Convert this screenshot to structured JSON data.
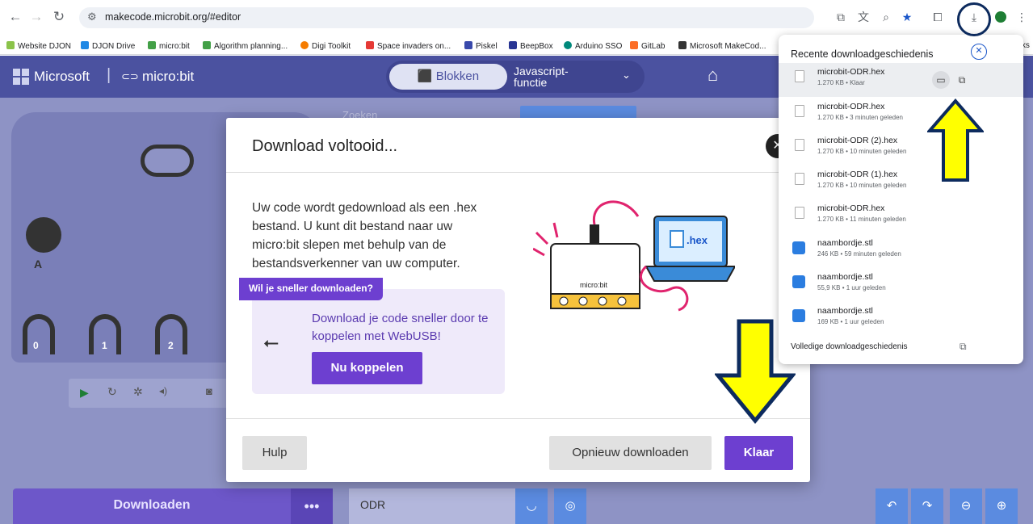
{
  "browser": {
    "url": "makecode.microbit.org/#editor",
    "bookmarks": [
      {
        "label": "Website DJON",
        "color": "#8bc34a"
      },
      {
        "label": "DJON Drive",
        "color": "#1e88e5"
      },
      {
        "label": "micro:bit",
        "color": "#43a047"
      },
      {
        "label": "Algorithm planning...",
        "color": "#43a047"
      },
      {
        "label": "Digi Toolkit",
        "color": "#f57c00"
      },
      {
        "label": "Space invaders on...",
        "color": "#e53935"
      },
      {
        "label": "Piskel",
        "color": "#3949ab"
      },
      {
        "label": "BeepBox",
        "color": "#283593"
      },
      {
        "label": "Arduino SSO",
        "color": "#00897b"
      },
      {
        "label": "GitLab",
        "color": "#fc6d26"
      },
      {
        "label": "Microsoft MakeCod...",
        "color": "#333333"
      }
    ],
    "bookmarks_overflow": "bookmarks"
  },
  "app": {
    "brand": "Microsoft",
    "product": "micro:bit",
    "mode_blocks": "Blokken",
    "mode_js": "Javascript-\nfunctie",
    "search_placeholder": "Zoeken",
    "download_label": "Downloaden",
    "more_label": "•••",
    "project_name": "ODR",
    "sim_pins": [
      "0",
      "1",
      "2"
    ]
  },
  "dialog": {
    "title": "Download voltooid...",
    "body": "Uw code wordt gedownload als een .hex bestand. U kunt dit bestand naar uw micro:bit slepen met behulp van de bestandsverkenner van uw computer.",
    "tag": "Wil je sneller downloaden?",
    "usb_text": "Download je code sneller door te koppelen met WebUSB!",
    "connect_label": "Nu koppelen",
    "help_label": "Hulp",
    "redownload_label": "Opnieuw downloaden",
    "done_label": "Klaar",
    "illustration_label": ".hex",
    "board_label": "micro:bit"
  },
  "downloads": {
    "title": "Recente downloadgeschiedenis",
    "items": [
      {
        "name": "microbit-ODR.hex",
        "meta": "1.270 KB • Klaar",
        "type": "hex"
      },
      {
        "name": "microbit-ODR.hex",
        "meta": "1.270 KB • 3 minuten geleden",
        "type": "hex"
      },
      {
        "name": "microbit-ODR (2).hex",
        "meta": "1.270 KB • 10 minuten geleden",
        "type": "hex"
      },
      {
        "name": "microbit-ODR (1).hex",
        "meta": "1.270 KB • 10 minuten geleden",
        "type": "hex"
      },
      {
        "name": "microbit-ODR.hex",
        "meta": "1.270 KB • 11 minuten geleden",
        "type": "hex"
      },
      {
        "name": "naambordje.stl",
        "meta": "246 KB • 59 minuten geleden",
        "type": "stl"
      },
      {
        "name": "naambordje.stl",
        "meta": "55,9 KB • 1 uur geleden",
        "type": "stl"
      },
      {
        "name": "naambordje.stl",
        "meta": "169 KB • 1 uur geleden",
        "type": "stl"
      }
    ],
    "full_history": "Volledige downloadgeschiedenis"
  },
  "colors": {
    "accent": "#6d3fd0",
    "header": "#4b52a0",
    "arrow_fill": "#ffff00",
    "arrow_stroke": "#0d2b5e"
  }
}
